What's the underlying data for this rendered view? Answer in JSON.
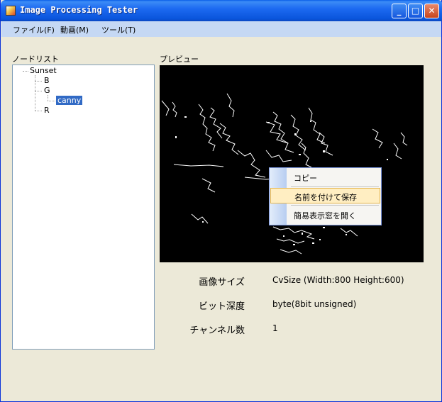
{
  "window": {
    "title": "Image Processing Tester",
    "title_buttons": {
      "minimize": "_",
      "maximize": "□",
      "close": "✕"
    }
  },
  "menu": [
    "ファイル(F)",
    "動画(M)",
    "ツール(T)"
  ],
  "node_list": {
    "label": "ノードリスト",
    "root": "Sunset",
    "children": [
      "B",
      "G",
      "R"
    ],
    "grandchild": "canny"
  },
  "preview": {
    "label": "プレビュー"
  },
  "context_menu": {
    "items": [
      "コピー",
      "名前を付けて保存",
      "簡易表示窓を開く"
    ],
    "highlighted_index": 1
  },
  "info": [
    {
      "label": "画像サイズ",
      "value": "CvSize (Width:800 Height:600)"
    },
    {
      "label": "ビット深度",
      "value": "byte(8bit unsigned)"
    },
    {
      "label": "チャンネル数",
      "value": "1"
    }
  ],
  "colors": {
    "titlebar": "#0a55dc",
    "menubar": "#c5d8f4",
    "window_bg": "#ece9d8",
    "selection": "#316ac5",
    "menu_highlight": "#ffeec2"
  }
}
